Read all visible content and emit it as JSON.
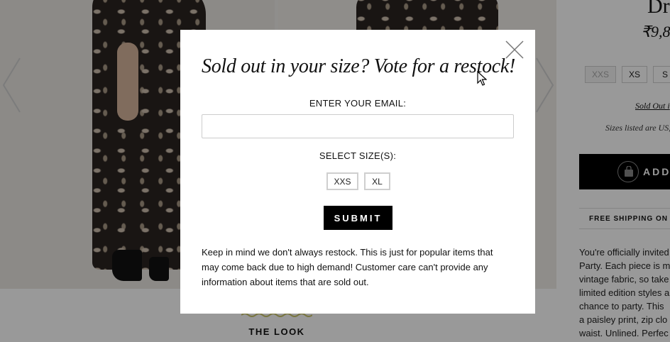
{
  "background": {
    "the_look": "THE LOOK",
    "product": {
      "title": "Dr",
      "price": "₹9,8",
      "sizes": [
        "XXS",
        "XS",
        "S"
      ],
      "sold_out_link": "Sold Out i",
      "sizes_note": "Sizes listed are US,",
      "add_button": "ADD",
      "shipping": "FREE SHIPPING ON IN",
      "description_lines": [
        "You're officially invited",
        "Party. Each piece is m",
        "vintage fabric, so take",
        "limited edition styles a",
        "chance to party. This",
        "a paisley print, zip clo",
        "waist. Unlined. Perfec"
      ]
    }
  },
  "modal": {
    "title": "Sold out in your size? Vote for a restock!",
    "email_label": "ENTER YOUR EMAIL:",
    "email_value": "",
    "email_placeholder": "",
    "size_label": "SELECT SIZE(S):",
    "size_options": [
      "XXS",
      "XL"
    ],
    "submit_label": "SUBMIT",
    "disclaimer_lines": [
      "Keep in mind we don't always restock. This is just for popular items that",
      "may come back due to high demand! Customer care can't provide any",
      "information about items that are sold out."
    ]
  },
  "colors": {
    "overlay": "rgba(0,0,0,0.4)",
    "button_bg": "#000000",
    "squiggle": "#c8c46a"
  },
  "icons": {
    "close": "close-icon",
    "bag": "shopping-bag-icon",
    "prev": "chevron-left-icon",
    "next": "chevron-right-icon"
  }
}
